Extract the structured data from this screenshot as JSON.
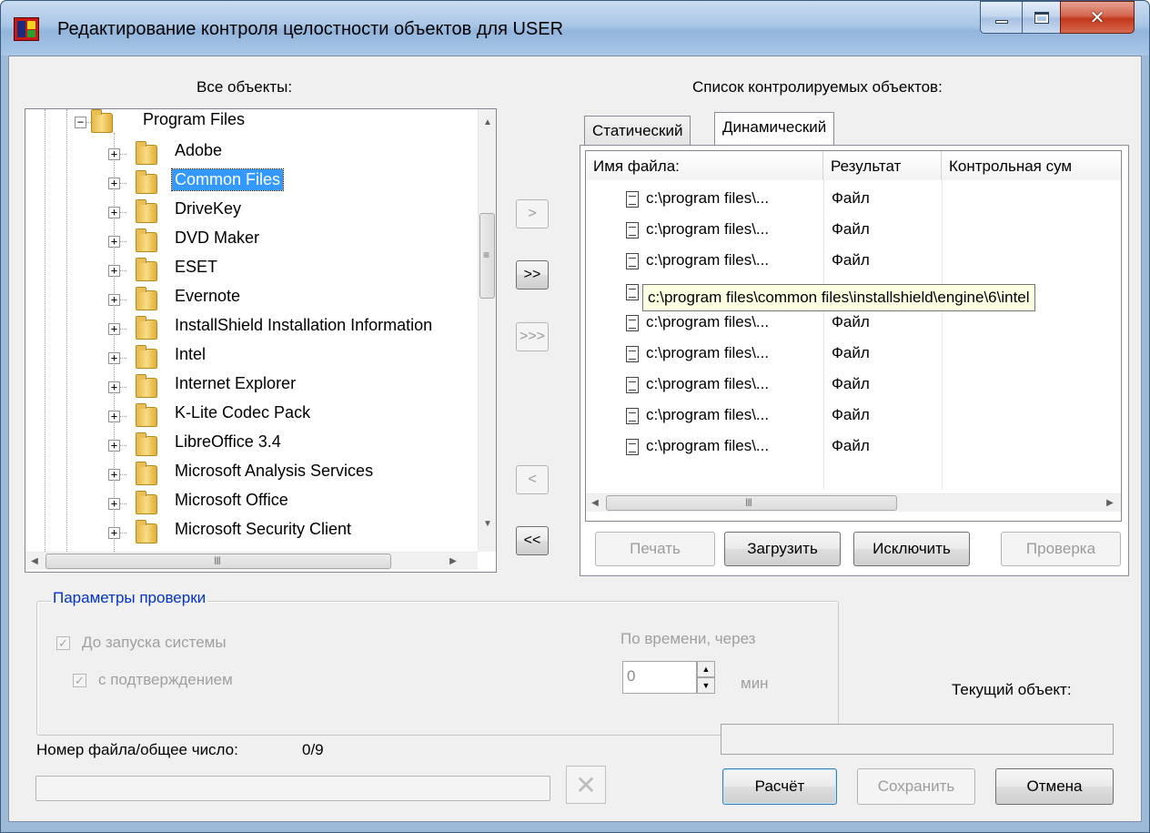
{
  "window": {
    "title": "Редактирование контроля целостности объектов для USER",
    "close_glyph": "✕"
  },
  "left": {
    "heading": "Все объекты:",
    "tree": {
      "root": "Program Files",
      "items": [
        "Adobe",
        "Common Files",
        "DriveKey",
        "DVD Maker",
        "ESET",
        "Evernote",
        "InstallShield Installation Information",
        "Intel",
        "Internet Explorer",
        "K-Lite Codec Pack",
        "LibreOffice 3.4",
        "Microsoft Analysis Services",
        "Microsoft Office",
        "Microsoft Security Client"
      ],
      "selected": "Common Files",
      "expand_glyph": "+",
      "collapse_glyph": "−",
      "grip": "|||"
    }
  },
  "transfer": {
    "add_one": ">",
    "add_all": ">>",
    "add_recursive": ">>>",
    "remove_one": "<",
    "remove_all": "<<"
  },
  "right": {
    "heading": "Список контролируемых объектов:",
    "tabs": [
      "Статический",
      "Динамический"
    ],
    "active_tab": "Динамический",
    "columns": [
      "Имя файла:",
      "Результат",
      "Контрольная сум"
    ],
    "rows": [
      {
        "name": "c:\\program files\\...",
        "result": "Файл"
      },
      {
        "name": "c:\\program files\\...",
        "result": "Файл"
      },
      {
        "name": "c:\\program files\\...",
        "result": "Файл"
      },
      {
        "name": "",
        "result": ""
      },
      {
        "name": "c:\\program files\\...",
        "result": "Файл"
      },
      {
        "name": "c:\\program files\\...",
        "result": "Файл"
      },
      {
        "name": "c:\\program files\\...",
        "result": "Файл"
      },
      {
        "name": "c:\\program files\\...",
        "result": "Файл"
      },
      {
        "name": "c:\\program files\\...",
        "result": "Файл"
      }
    ],
    "tooltip": "c:\\program files\\common files\\installshield\\engine\\6\\intel",
    "buttons": {
      "print": "Печать",
      "load": "Загрузить",
      "exclude": "Исключить",
      "check": "Проверка"
    }
  },
  "params": {
    "title": "Параметры проверки",
    "before_start": "До запуска системы",
    "with_confirm": "с подтверждением",
    "by_time": "По времени, через",
    "interval_value": "0",
    "unit": "мин",
    "check_glyph": "✓",
    "spin_up": "▲",
    "spin_down": "▼"
  },
  "status": {
    "file_counter_label": "Номер файла/общее число:",
    "file_counter_value": "0/9",
    "current_object_label": "Текущий объект:",
    "file_progress": 0,
    "stop_glyph": "✕"
  },
  "footer": {
    "calculate": "Расчёт",
    "save": "Сохранить",
    "cancel": "Отмена"
  },
  "scrollbars": {
    "up": "▲",
    "down": "▼",
    "left": "◀",
    "right": "▶",
    "grip_h": "III",
    "grip_v": "≡"
  }
}
